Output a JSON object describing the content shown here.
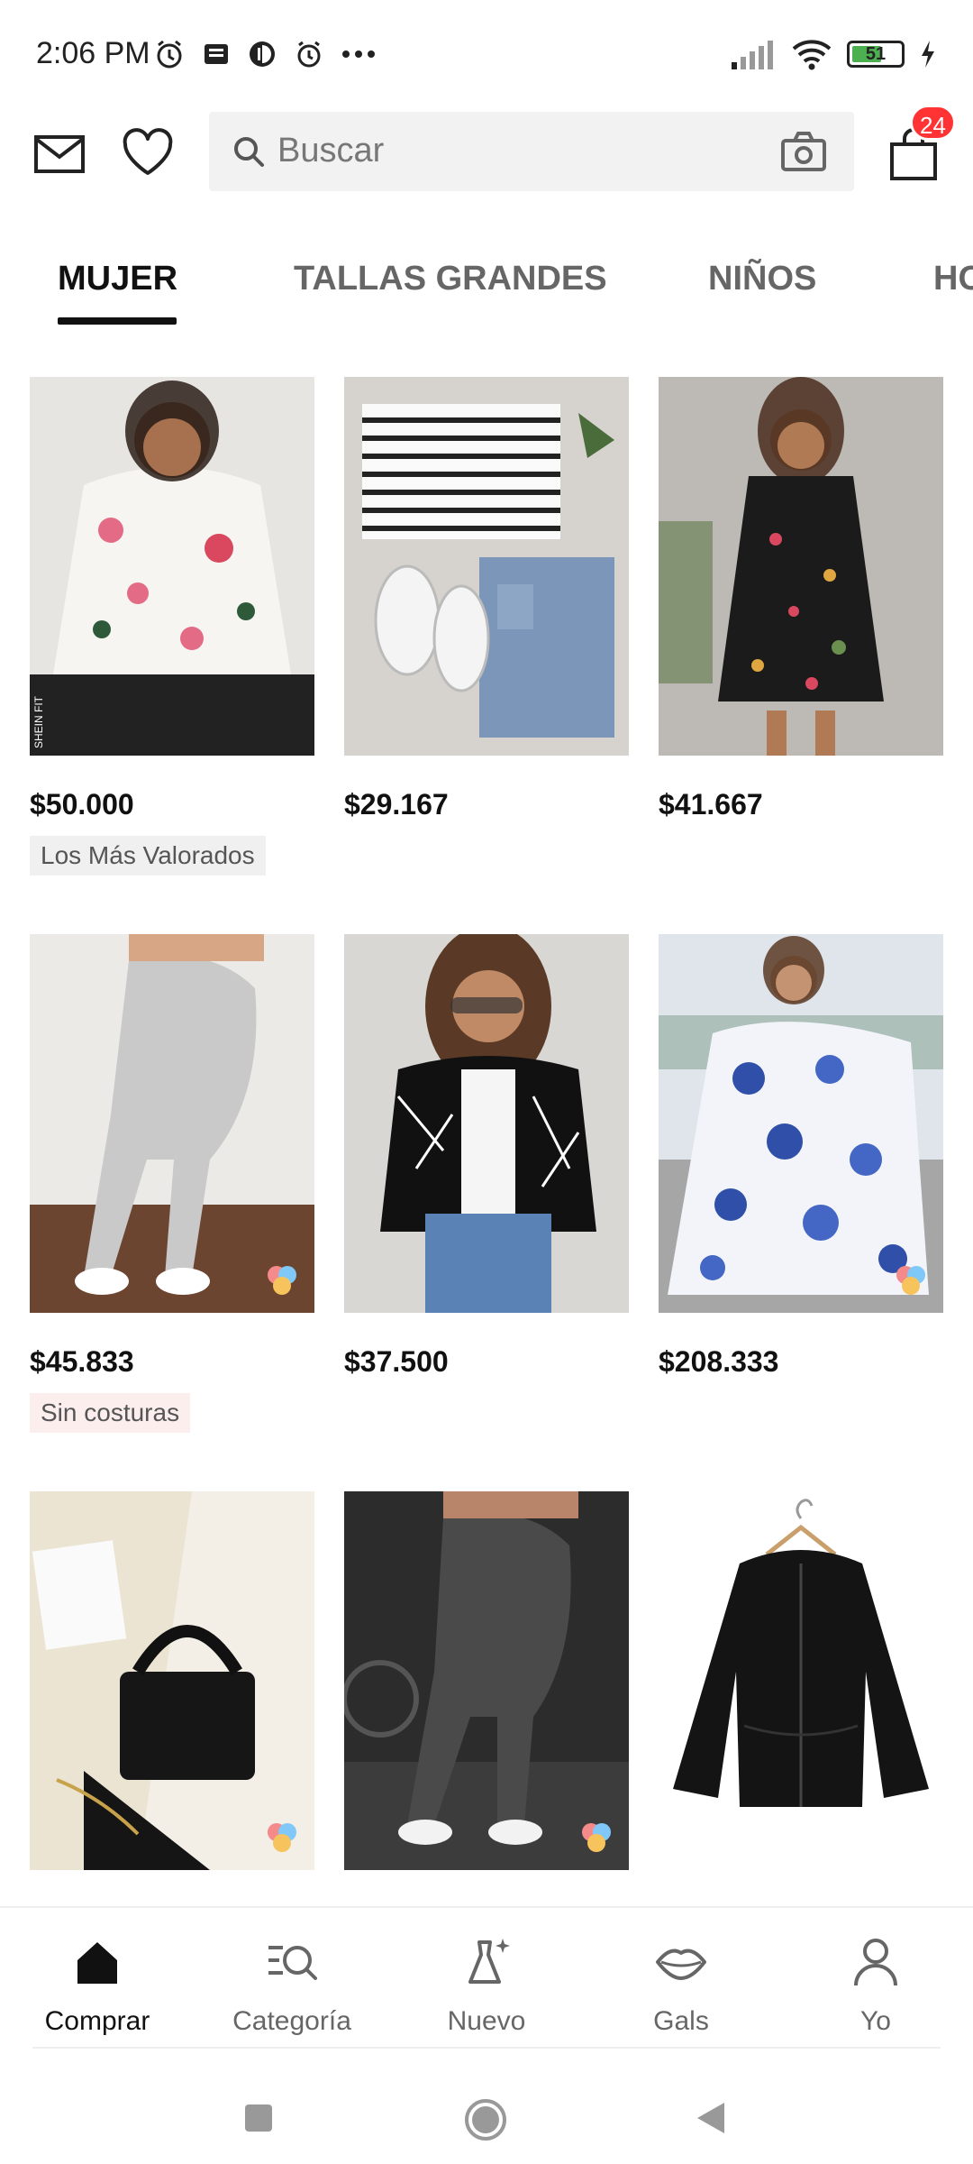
{
  "status_bar": {
    "time": "2:06 PM",
    "battery_level": "51",
    "icons_left": [
      "alarm-icon",
      "news-icon",
      "app-icon",
      "alarm-clock-icon",
      "more-icon"
    ],
    "icons_right": [
      "signal-icon",
      "wifi-icon",
      "battery-icon",
      "charging-icon"
    ]
  },
  "header": {
    "search_placeholder": "Buscar",
    "cart_count": "24",
    "icons": [
      "mail-icon",
      "heart-icon",
      "search-icon",
      "camera-icon",
      "bag-icon"
    ]
  },
  "tabs": [
    {
      "label": "MUJER",
      "active": true
    },
    {
      "label": "TALLAS GRANDES",
      "active": false
    },
    {
      "label": "NIÑOS",
      "active": false
    },
    {
      "label": "HO",
      "active": false
    }
  ],
  "products": [
    {
      "price": "$50.000",
      "tag": "Los Más Valorados",
      "tag_style": "gray",
      "image": "floral-blouse-image"
    },
    {
      "price": "$29.167",
      "tag": "",
      "image": "striped-top-jeans-image"
    },
    {
      "price": "$41.667",
      "tag": "",
      "image": "embroidered-dress-image"
    },
    {
      "price": "$45.833",
      "tag": "Sin costuras",
      "tag_style": "pink",
      "image": "gray-leggings-image"
    },
    {
      "price": "$37.500",
      "tag": "",
      "image": "geometric-jacket-image"
    },
    {
      "price": "$208.333",
      "tag": "",
      "image": "blue-floral-dress-image"
    },
    {
      "price": "",
      "tag": "",
      "image": "black-handbag-image"
    },
    {
      "price": "",
      "tag": "",
      "image": "dark-leggings-image"
    },
    {
      "price": "",
      "tag": "",
      "image": "black-jacket-image"
    }
  ],
  "bottom_nav": [
    {
      "label": "Comprar",
      "icon": "home-icon",
      "active": true
    },
    {
      "label": "Categoría",
      "icon": "category-search-icon",
      "active": false
    },
    {
      "label": "Nuevo",
      "icon": "dress-sparkle-icon",
      "active": false
    },
    {
      "label": "Gals",
      "icon": "lips-icon",
      "active": false
    },
    {
      "label": "Yo",
      "icon": "person-icon",
      "active": false
    }
  ],
  "colors": {
    "badge": "#ff3333",
    "active_text": "#111111",
    "inactive_text": "#666666"
  }
}
